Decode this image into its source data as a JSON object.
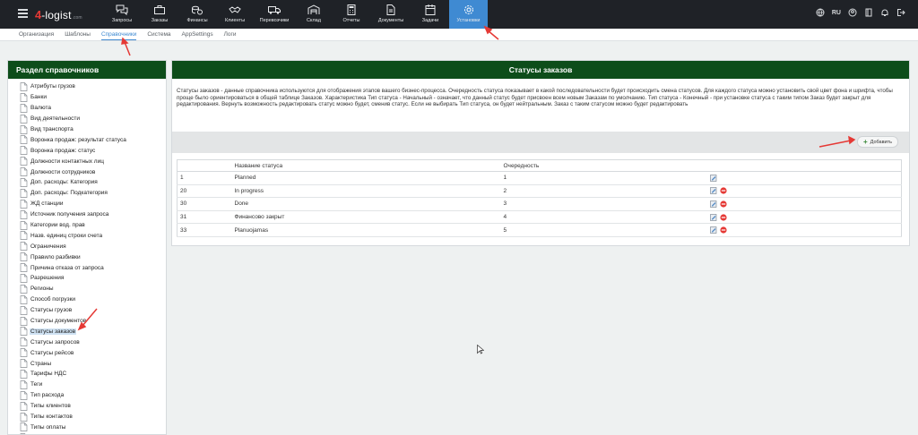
{
  "header": {
    "logo_num": "4",
    "logo_text": "-logist",
    "logo_sub": ".com",
    "nav": [
      {
        "label": "Запросы",
        "icon": "chat-icon"
      },
      {
        "label": "Заказы",
        "icon": "briefcase-icon"
      },
      {
        "label": "Финансы",
        "icon": "coins-icon"
      },
      {
        "label": "Клиенты",
        "icon": "handshake-icon"
      },
      {
        "label": "Перевозчики",
        "icon": "truck-icon"
      },
      {
        "label": "Склад",
        "icon": "warehouse-icon"
      },
      {
        "label": "Отчеты",
        "icon": "calculator-icon"
      },
      {
        "label": "Документы",
        "icon": "document-icon"
      },
      {
        "label": "Задачи",
        "icon": "calendar-icon"
      },
      {
        "label": "Установки",
        "icon": "gear-icon"
      }
    ],
    "lang": "RU",
    "tools": [
      "globe-icon",
      "user-icon",
      "book-icon",
      "bell-icon",
      "logout-icon"
    ]
  },
  "submenu": [
    "Организация",
    "Шаблоны",
    "Справочники",
    "Система",
    "AppSettings",
    "Логи"
  ],
  "sidebar": {
    "title": "Раздел справочников",
    "items": [
      "Атрибуты грузов",
      "Банки",
      "Валюта",
      "Вид деятельности",
      "Вид транспорта",
      "Воронка продаж: результат статуса",
      "Воронка продаж: статус",
      "Должности контактных лиц",
      "Должности сотрудников",
      "Доп. расходы: Категория",
      "Доп. расходы: Подкатегория",
      "ЖД станции",
      "Источник получения запроса",
      "Категории вод. прав",
      "Назв. единиц строки счета",
      "Ограничения",
      "Правило разбивки",
      "Причина отказа от запроса",
      "Разрешения",
      "Регионы",
      "Способ погрузки",
      "Статусы грузов",
      "Статусы документов",
      "Статусы заказов",
      "Статусы запросов",
      "Статусы рейсов",
      "Страны",
      "Тарифы НДС",
      "Теги",
      "Тип расхода",
      "Типы клиентов",
      "Типы контактов",
      "Типы оплаты",
      "Типы оплат"
    ],
    "selected": "Статусы заказов"
  },
  "main": {
    "title": "Статусы заказов",
    "description": "Статусы заказов - данные справочника используются для отображения этапов вашего бизнес-процесса. Очередность статуса показывает в какой последовательности будет происходить смена статусов. Для каждого статуса можно установить свой цвет фона и шрифта, чтобы проще было ориентироваться в общей таблице Заказов. Характеристика Тип статуса - Начальный - означает, что данный статус будет присвоен всем новым Заказам по умолчанию. Тип статуса - Конечный - при установке статуса с таким типом Заказ будет закрыт для редактирования. Вернуть возможность редактировать статус можно будет, сменив статус. Если не выбирать Тип статуса, он будет нейтральным. Заказ с таким статусом можно будет редактировать",
    "add_label": "Добавить",
    "columns": [
      "",
      "Название статуса",
      "Очередность",
      ""
    ],
    "rows": [
      {
        "id": "1",
        "name": "Planned",
        "order": "1",
        "deletable": false
      },
      {
        "id": "20",
        "name": "In progress",
        "order": "2",
        "deletable": true
      },
      {
        "id": "30",
        "name": "Done",
        "order": "3",
        "deletable": true
      },
      {
        "id": "31",
        "name": "Финансово закрыт",
        "order": "4",
        "deletable": true
      },
      {
        "id": "33",
        "name": "Planuojamas",
        "order": "5",
        "deletable": true
      }
    ]
  },
  "colors": {
    "topbar": "#1f2227",
    "accent": "#3f8ad2",
    "panel_header": "#0d4d1a",
    "annotation": "#e53935"
  }
}
